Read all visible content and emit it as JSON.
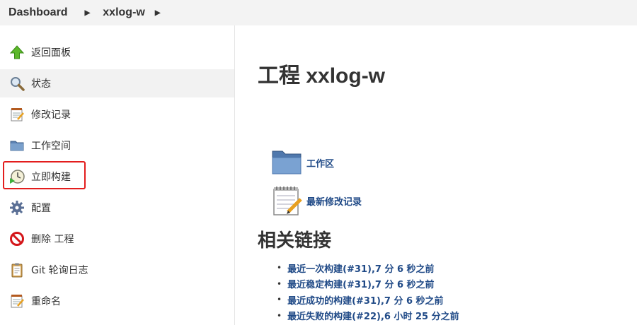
{
  "breadcrumb": {
    "root": "Dashboard",
    "project": "xxlog-w"
  },
  "sidebar": {
    "items": [
      {
        "label": "返回面板",
        "icon": "up-arrow-icon"
      },
      {
        "label": "状态",
        "icon": "magnifier-icon"
      },
      {
        "label": "修改记录",
        "icon": "notepad-icon"
      },
      {
        "label": "工作空间",
        "icon": "folder-icon"
      },
      {
        "label": "立即构建",
        "icon": "build-clock-icon"
      },
      {
        "label": "配置",
        "icon": "gear-icon"
      },
      {
        "label": "删除 工程",
        "icon": "no-entry-icon"
      },
      {
        "label": "Git 轮询日志",
        "icon": "clipboard-icon"
      },
      {
        "label": "重命名",
        "icon": "notepad-icon"
      }
    ],
    "active_item": "状态",
    "highlighted_item": "立即构建"
  },
  "main": {
    "title": "工程 xxlog-w",
    "tiles": [
      {
        "label": "工作区",
        "icon": "folder-icon"
      },
      {
        "label": "最新修改记录",
        "icon": "notepad-icon"
      }
    ],
    "related_title": "相关链接",
    "related_links": [
      "最近一次构建(#31),7 分 6 秒之前",
      "最近稳定构建(#31),7 分 6 秒之前",
      "最近成功的构建(#31),7 分 6 秒之前",
      "最近失败的构建(#22),6 小时 25 分之前"
    ]
  },
  "colors": {
    "link": "#204a87",
    "highlight": "#e31d1d",
    "breadcrumb_bg": "#f3f3f3"
  }
}
